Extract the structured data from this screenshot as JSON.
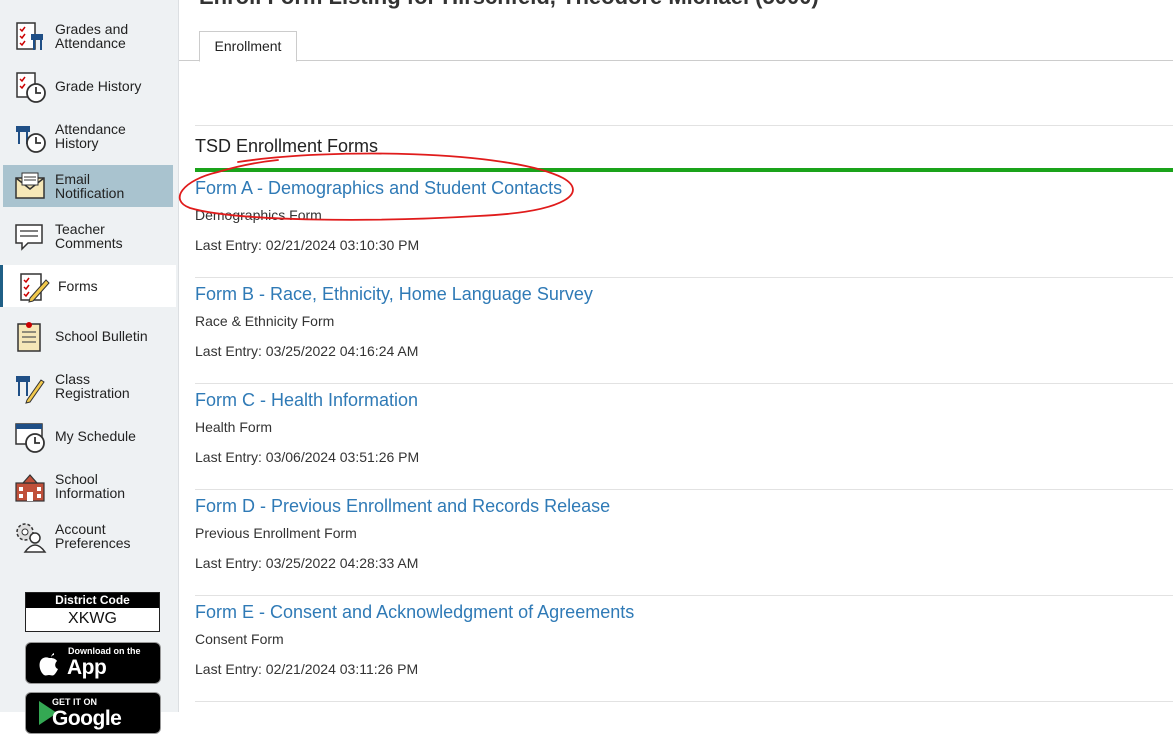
{
  "page": {
    "title": "Enroll Form Listing for Hirschfeld, Theodore Michael (5000)"
  },
  "sidebar": {
    "items": [
      {
        "label": "Grades and\nAttendance",
        "icon": "grades-attendance-icon"
      },
      {
        "label": "Grade History",
        "icon": "grade-history-icon"
      },
      {
        "label": "Attendance\nHistory",
        "icon": "attendance-history-icon"
      },
      {
        "label": "Email\nNotification",
        "icon": "email-notification-icon"
      },
      {
        "label": "Teacher\nComments",
        "icon": "teacher-comments-icon"
      },
      {
        "label": "Forms",
        "icon": "forms-icon"
      },
      {
        "label": "School Bulletin",
        "icon": "school-bulletin-icon"
      },
      {
        "label": "Class\nRegistration",
        "icon": "class-registration-icon"
      },
      {
        "label": "My Schedule",
        "icon": "my-schedule-icon"
      },
      {
        "label": "School\nInformation",
        "icon": "school-information-icon"
      },
      {
        "label": "Account\nPreferences",
        "icon": "account-preferences-icon"
      }
    ],
    "district_code_label": "District Code",
    "district_code": "XKWG",
    "app_store": {
      "small": "Download on the",
      "big": "App Store"
    },
    "google_play": {
      "small": "GET IT ON",
      "big": "Google Play"
    }
  },
  "tabs": [
    {
      "label": "Enrollment"
    }
  ],
  "section": {
    "title": "TSD Enrollment Forms"
  },
  "forms": [
    {
      "title": "Form A - Demographics and Student Contacts",
      "description": "Demographics Form",
      "last_entry": "Last Entry: 02/21/2024 03:10:30 PM"
    },
    {
      "title": "Form B - Race, Ethnicity, Home Language Survey",
      "description": "Race & Ethnicity Form",
      "last_entry": "Last Entry: 03/25/2022 04:16:24 AM"
    },
    {
      "title": "Form C - Health Information",
      "description": "Health Form",
      "last_entry": "Last Entry: 03/06/2024 03:51:26 PM"
    },
    {
      "title": "Form D - Previous Enrollment and Records Release",
      "description": "Previous Enrollment Form",
      "last_entry": "Last Entry: 03/25/2022 04:28:33 AM"
    },
    {
      "title": "Form E - Consent and Acknowledgment of Agreements",
      "description": "Consent Form",
      "last_entry": "Last Entry: 02/21/2024 03:11:26 PM"
    }
  ],
  "colors": {
    "link": "#2f7ab6",
    "section_underline": "#1aa31a",
    "selected_nav": "#a9c3cf",
    "annotation": "#e01b1b"
  }
}
